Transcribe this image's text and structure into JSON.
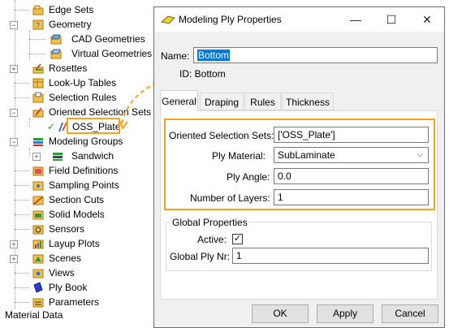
{
  "tree": {
    "items": [
      {
        "label": "Edge Sets",
        "icon": "edge-sets-icon"
      },
      {
        "label": "Geometry",
        "icon": "geometry-icon"
      },
      {
        "label": "CAD Geometries",
        "icon": "cad-geometries-icon"
      },
      {
        "label": "Virtual Geometries",
        "icon": "virtual-geometries-icon"
      },
      {
        "label": "Rosettes",
        "icon": "rosettes-icon"
      },
      {
        "label": "Look-Up Tables",
        "icon": "lookup-tables-icon"
      },
      {
        "label": "Selection Rules",
        "icon": "selection-rules-icon"
      },
      {
        "label": "Oriented Selection Sets",
        "icon": "oriented-selection-sets-icon"
      },
      {
        "label": "OSS_Plate",
        "icon": "oss-plate-icon"
      },
      {
        "label": "Modeling Groups",
        "icon": "modeling-groups-icon"
      },
      {
        "label": "Sandwich",
        "icon": "sandwich-icon"
      },
      {
        "label": "Field Definitions",
        "icon": "field-definitions-icon"
      },
      {
        "label": "Sampling Points",
        "icon": "sampling-points-icon"
      },
      {
        "label": "Section Cuts",
        "icon": "section-cuts-icon"
      },
      {
        "label": "Solid Models",
        "icon": "solid-models-icon"
      },
      {
        "label": "Sensors",
        "icon": "sensors-icon"
      },
      {
        "label": "Layup Plots",
        "icon": "layup-plots-icon"
      },
      {
        "label": "Scenes",
        "icon": "scenes-icon"
      },
      {
        "label": "Views",
        "icon": "views-icon"
      },
      {
        "label": "Ply Book",
        "icon": "ply-book-icon"
      },
      {
        "label": "Parameters",
        "icon": "parameters-icon"
      }
    ],
    "status_text": "Material Data"
  },
  "dialog": {
    "title": "Modeling Ply Properties",
    "name_label": "Name:",
    "name_value": "Bottom",
    "id_text": "ID: Bottom",
    "tabs": [
      "General",
      "Draping",
      "Rules",
      "Thickness"
    ],
    "oss_label": "Oriented Selection Sets:",
    "oss_value": "['OSS_Plate']",
    "ply_material_label": "Ply Material:",
    "ply_material_value": "SubLaminate",
    "ply_angle_label": "Ply Angle:",
    "ply_angle_value": "0.0",
    "layers_label": "Number of Layers:",
    "layers_value": "1",
    "global_title": "Global Properties",
    "active_label": "Active:",
    "active_checked": true,
    "global_ply_label": "Global Ply Nr:",
    "global_ply_value": "1",
    "ok_label": "OK",
    "apply_label": "Apply",
    "cancel_label": "Cancel"
  },
  "colors": {
    "highlight": "#f3a31c",
    "selection": "#0078d7"
  }
}
